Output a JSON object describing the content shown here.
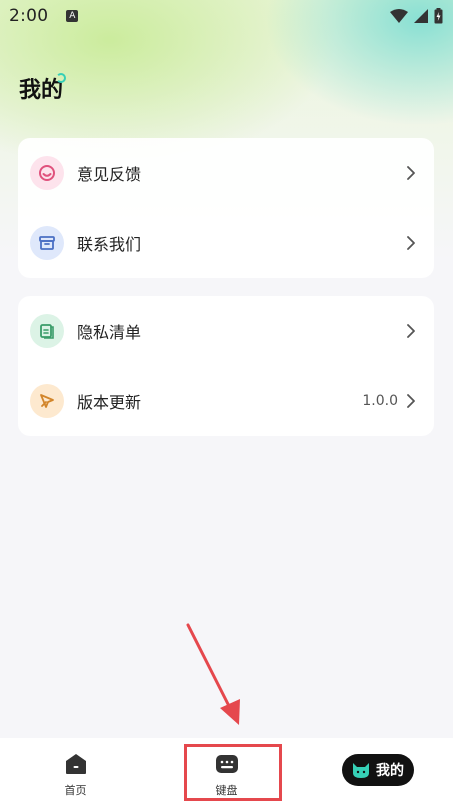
{
  "status": {
    "time": "2:00",
    "app_icon": "A"
  },
  "header": {
    "title": "我的"
  },
  "settings_group_1": [
    {
      "label": "意见反馈",
      "icon": "feedback-smile-icon",
      "icon_bg": "#fde3ec",
      "icon_color": "#e0527d"
    },
    {
      "label": "联系我们",
      "icon": "contact-box-icon",
      "icon_bg": "#dfe8fb",
      "icon_color": "#4a6fc4"
    }
  ],
  "settings_group_2": [
    {
      "label": "隐私清单",
      "icon": "privacy-doc-icon",
      "icon_bg": "#dcf3e6",
      "icon_color": "#3a9c69"
    },
    {
      "label": "版本更新",
      "icon": "rocket-icon",
      "icon_bg": "#fde9cf",
      "icon_color": "#d2852a",
      "value": "1.0.0"
    }
  ],
  "tabbar": {
    "home_label": "首页",
    "keyboard_label": "键盘",
    "mine_label": "我的"
  },
  "colors": {
    "accent_teal": "#36d0b6",
    "highlight_red": "#e5484d",
    "tab_active_bg": "#111111"
  }
}
